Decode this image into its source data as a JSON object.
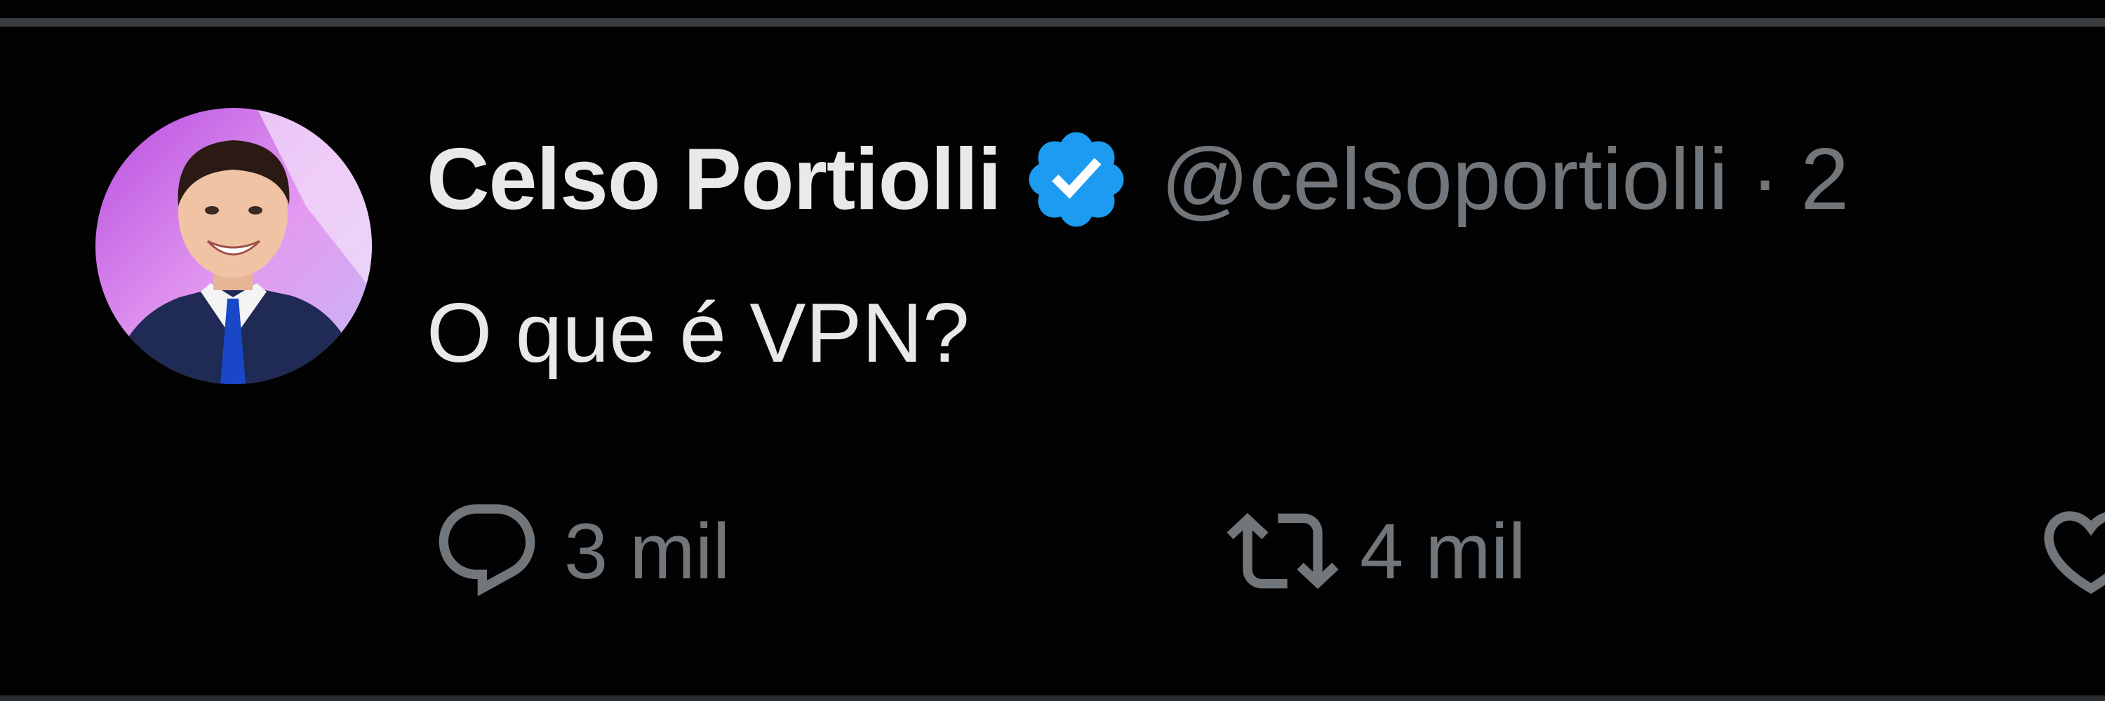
{
  "tweet": {
    "author": {
      "display_name": "Celso Portiolli",
      "handle": "@celsoportiolli",
      "verified": true,
      "avatar_icon": "avatar-photo"
    },
    "separator": "·",
    "time_partial": "2",
    "text": "O que é VPN?",
    "actions": {
      "reply": {
        "icon": "reply-icon",
        "count": "3 mil"
      },
      "retweet": {
        "icon": "retweet-icon",
        "count": "4 mil"
      },
      "like": {
        "icon": "heart-icon"
      }
    }
  },
  "colors": {
    "background": "#000000",
    "primary_text": "#e7e9ea",
    "secondary_text": "#71767b",
    "verified_blue": "#1d9bf0",
    "border": "#3a3d40"
  }
}
